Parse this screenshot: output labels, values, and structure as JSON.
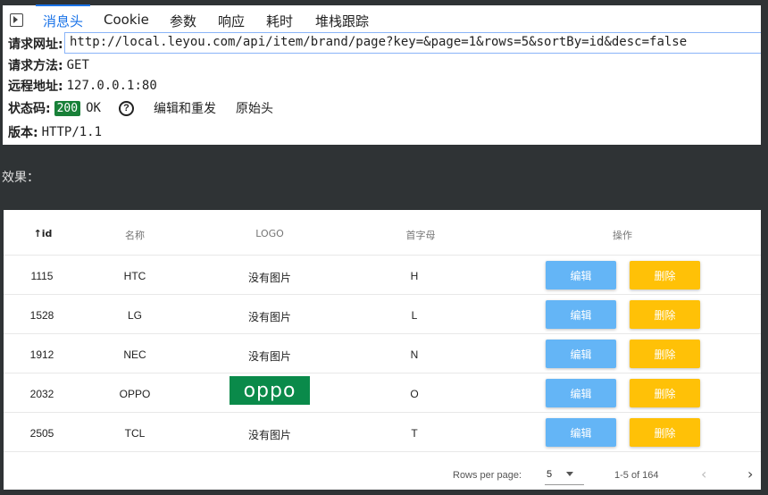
{
  "devtools": {
    "tabs": [
      "消息头",
      "Cookie",
      "参数",
      "响应",
      "耗时",
      "堆栈跟踪"
    ],
    "active_tab": "消息头",
    "request_url_label": "请求网址:",
    "request_url": "http://local.leyou.com/api/item/brand/page?key=&page=1&rows=5&sortBy=id&desc=false",
    "method_label": "请求方法:",
    "method": "GET",
    "remote_label": "远程地址:",
    "remote": "127.0.0.1:80",
    "status_label": "状态码:",
    "status_code": "200",
    "status_text": "OK",
    "edit_resend": "编辑和重发",
    "raw_headers": "原始头",
    "version_label": "版本:",
    "version": "HTTP/1.1"
  },
  "effect_label": "效果：",
  "table": {
    "headers": {
      "id": "id",
      "name": "名称",
      "logo": "LOGO",
      "letter": "首字母",
      "ops": "操作"
    },
    "rows": [
      {
        "id": "1115",
        "name": "HTC",
        "logo": "没有图片",
        "letter": "H"
      },
      {
        "id": "1528",
        "name": "LG",
        "logo": "没有图片",
        "letter": "L"
      },
      {
        "id": "1912",
        "name": "NEC",
        "logo": "没有图片",
        "letter": "N"
      },
      {
        "id": "2032",
        "name": "OPPO",
        "logo_text": "oppo",
        "letter": "O"
      },
      {
        "id": "2505",
        "name": "TCL",
        "logo": "没有图片",
        "letter": "T"
      }
    ],
    "edit_label": "编辑",
    "delete_label": "删除",
    "rows_per_page_label": "Rows per page:",
    "rows_per_page": "5",
    "range": "1-5 of 164"
  },
  "colors": {
    "edit": "#64b5f6",
    "delete": "#ffc107",
    "status": "#188038",
    "active_tab": "#1a73e8"
  },
  "icons": [
    "dock-icon",
    "help-icon",
    "sort-up-icon",
    "caret-down-icon",
    "chevron-left-icon",
    "chevron-right-icon"
  ]
}
